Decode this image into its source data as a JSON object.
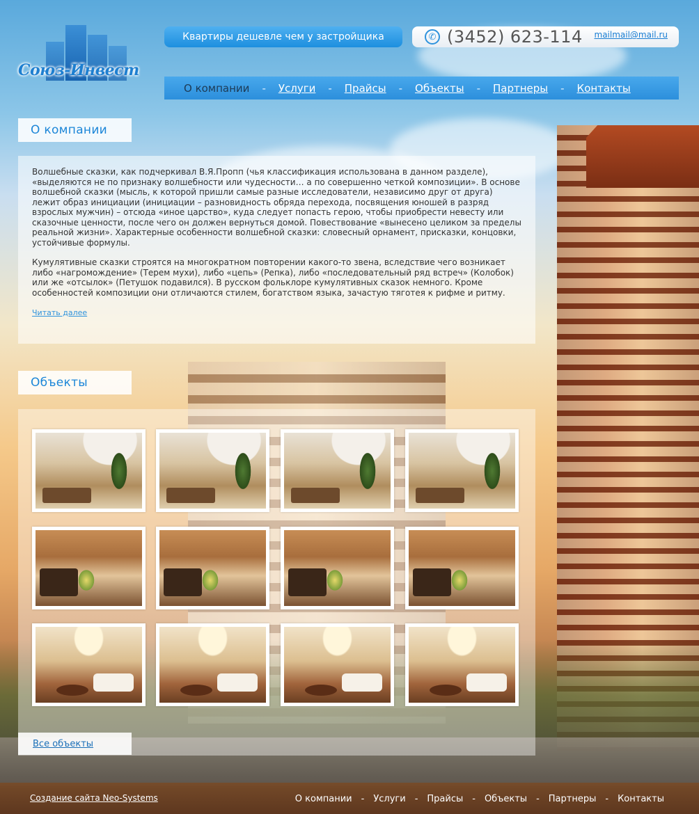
{
  "brand": {
    "logo_text": "Союз-Инвест"
  },
  "header": {
    "tagline": "Квартиры дешевле чем у застройщика",
    "phone": "(3452) 623-114",
    "email": "mailmail@mail.ru"
  },
  "nav": {
    "items": [
      {
        "label": "О компании",
        "active": true
      },
      {
        "label": "Услуги",
        "active": false
      },
      {
        "label": "Прайсы",
        "active": false
      },
      {
        "label": "Объекты",
        "active": false
      },
      {
        "label": "Партнеры",
        "active": false
      },
      {
        "label": "Контакты",
        "active": false
      }
    ],
    "separator": "-"
  },
  "about": {
    "title": "О компании",
    "paragraph1": "Волшебные сказки, как подчеркивал В.Я.Пропп (чья классификация использована в данном разделе), «выделяются не по признаку волшебности или чудесности… а по совершенно четкой композиции». В основе волшебной сказки (мысль, к которой пришли самые разные исследователи, независимо друг от друга) лежит образ инициации (инициации – разновидность обряда перехода, посвящения юношей в разряд взрослых мужчин) – отсюда «иное царство», куда следует попасть герою, чтобы приобрести невесту или сказочные ценности, после чего он должен вернуться домой. Повествование «вынесено целиком за пределы реальной жизни». Характерные особенности волшебной сказки: словесный орнамент, присказки, концовки, устойчивые формулы.",
    "paragraph2": "Кумулятивные сказки строятся на многократном повторении какого-то звена, вследствие чего возникает либо «нагромождение» (Терем мухи), либо «цепь» (Репка), либо «последовательный ряд встреч» (Колобок) или же «отсылок» (Петушок подавился). В русском фольклоре кумулятивных сказок немного. Кроме особенностей композиции они отличаются стилем, богатством языка, зачастую тяготея к рифме и ритму.",
    "read_more": "Читать далее"
  },
  "objects": {
    "title": "Объекты",
    "thumbnails": [
      {
        "image": "interior-staircase-living-room"
      },
      {
        "image": "interior-staircase-living-room"
      },
      {
        "image": "interior-staircase-living-room"
      },
      {
        "image": "interior-staircase-living-room"
      },
      {
        "image": "interior-kitchen-living-room"
      },
      {
        "image": "interior-kitchen-living-room"
      },
      {
        "image": "interior-kitchen-living-room"
      },
      {
        "image": "interior-kitchen-living-room"
      },
      {
        "image": "interior-dining-room-chandelier"
      },
      {
        "image": "interior-dining-room-chandelier"
      },
      {
        "image": "interior-dining-room-chandelier"
      },
      {
        "image": "interior-dining-room-chandelier"
      }
    ],
    "all_link": "Все объекты"
  },
  "footer": {
    "credit": "Создание сайта Neo-Systems",
    "nav": [
      "О компании",
      "Услуги",
      "Прайсы",
      "Объекты",
      "Партнеры",
      "Контакты"
    ],
    "separator": "-"
  },
  "colors": {
    "accent_blue": "#2c8fdc",
    "heading_blue": "#1c86d8",
    "footer_brown": "#6e4426"
  }
}
